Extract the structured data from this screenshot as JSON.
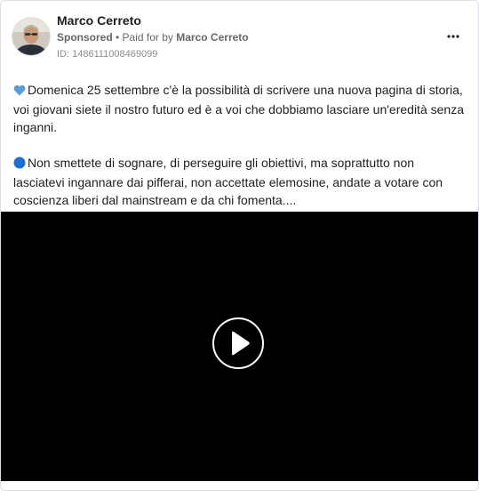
{
  "post": {
    "page_name": "Marco Cerreto",
    "sponsored_label": "Sponsored",
    "separator": " • ",
    "paid_for_prefix": "Paid for by ",
    "paid_for_name": "Marco Cerreto",
    "ad_id": "ID: 1486111008469099",
    "paragraph_1": "Domenica 25 settembre c'è la possibilità di scrivere una nuova pagina di storia, voi giovani siete il nostro futuro ed è a voi che dobbiamo lasciare un'eredità senza inganni.",
    "paragraph_2": "Non smettete di sognare, di perseguire gli obiettivi, ma soprattutto non lasciatevi ingannare dai pifferai, non accettate elemosine, andate a votare con coscienza liberi dal mainstream e da chi fomenta...."
  },
  "icons": {
    "heart": "blue-heart-icon",
    "circle": "blue-circle-icon",
    "more": "more-options-icon",
    "play": "play-icon"
  },
  "colors": {
    "heart": "#5b9bd5",
    "circle": "#1f6fd1",
    "video_bg": "#000000"
  }
}
